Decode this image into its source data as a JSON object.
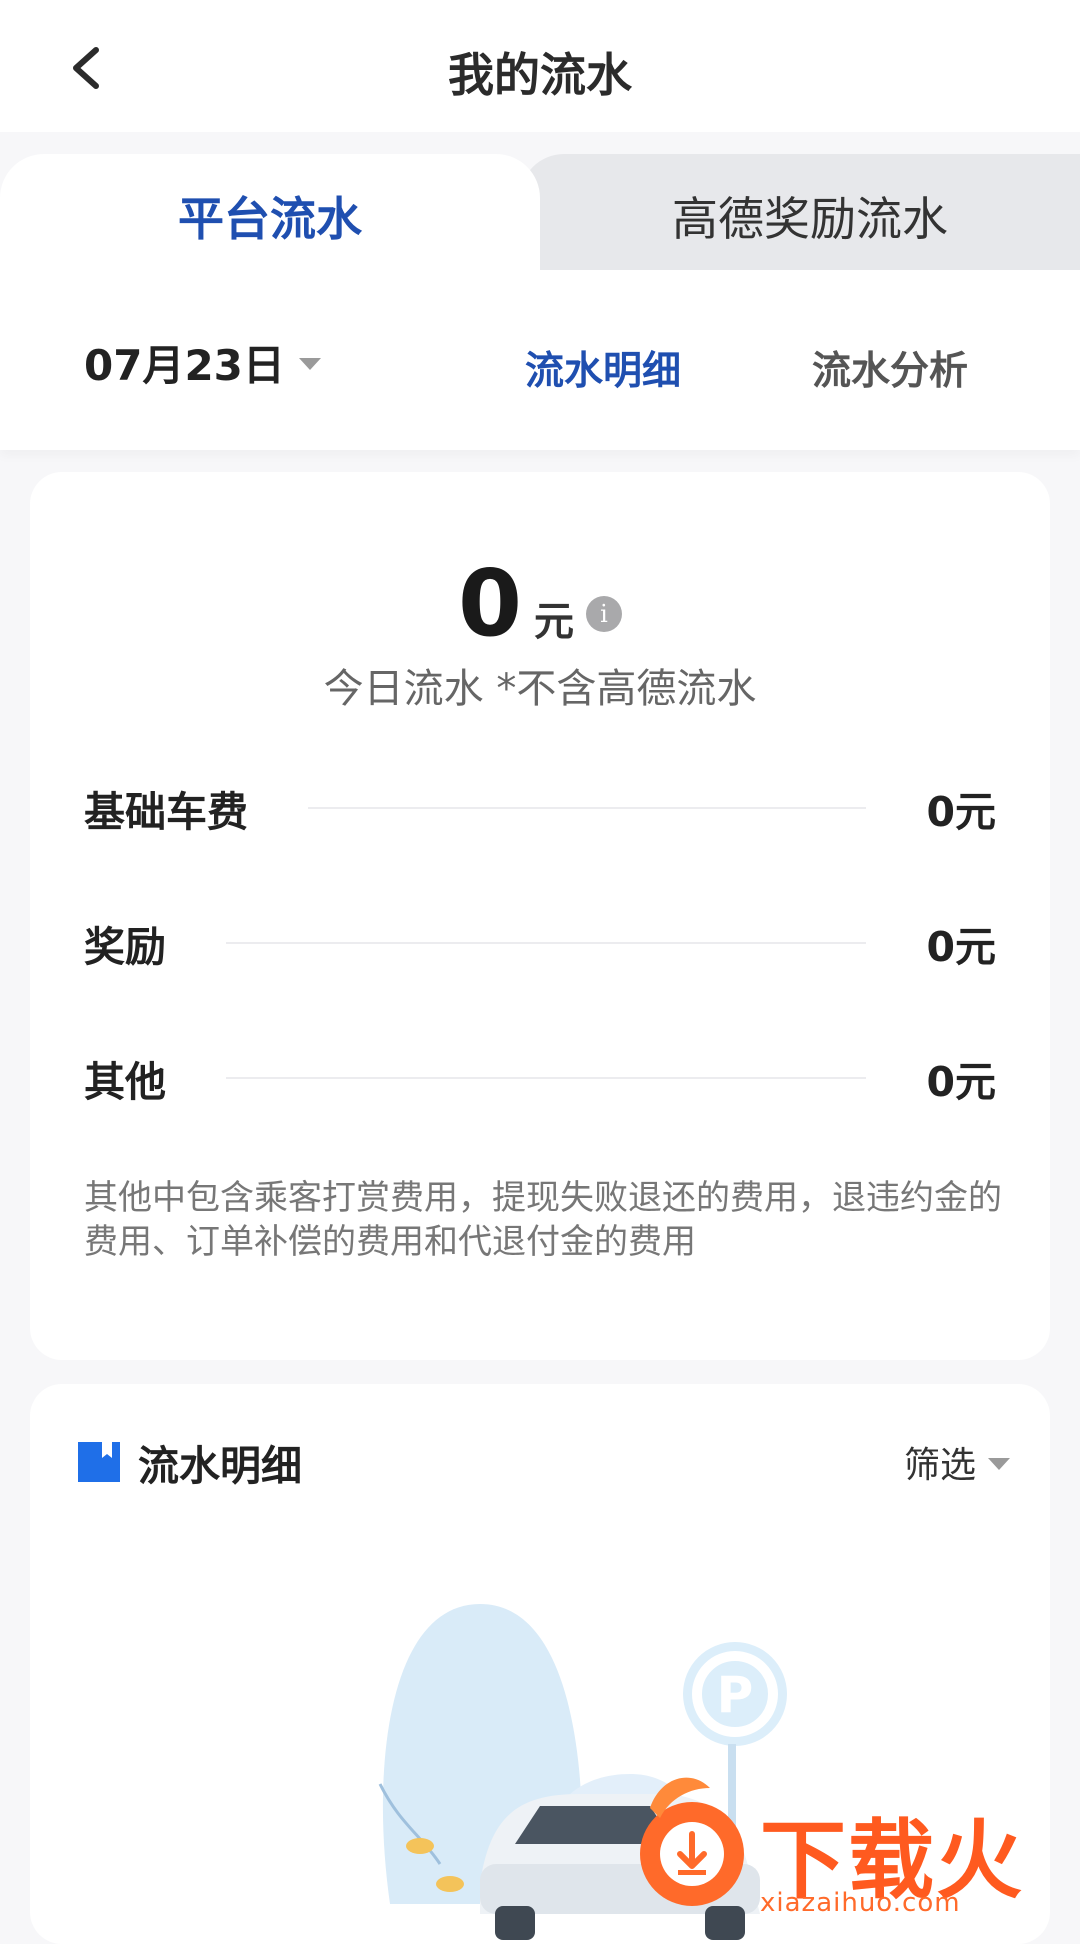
{
  "header": {
    "title": "我的流水"
  },
  "tabs": {
    "platform": "平台流水",
    "amap_reward": "高德奖励流水"
  },
  "subbar": {
    "date": "07月23日",
    "detail_tab": "流水明细",
    "analysis_tab": "流水分析"
  },
  "summary": {
    "total_value": "0",
    "total_unit": "元",
    "caption": "今日流水 *不含高德流水",
    "rows": [
      {
        "label": "基础车费",
        "value": "0元"
      },
      {
        "label": "奖励",
        "value": "0元"
      },
      {
        "label": "其他",
        "value": "0元"
      }
    ],
    "note": "其他中包含乘客打赏费用，提现失败退还的费用，退违约金的费用、订单补偿的费用和代退付金的费用"
  },
  "details": {
    "title": "流水明细",
    "filter": "筛选"
  },
  "watermark": {
    "text": "下载火",
    "url": "xiazaihuo.com"
  },
  "colors": {
    "accent": "#1f4fb0",
    "icon_blue": "#1f6fe8",
    "watermark": "#ff5a1f"
  }
}
